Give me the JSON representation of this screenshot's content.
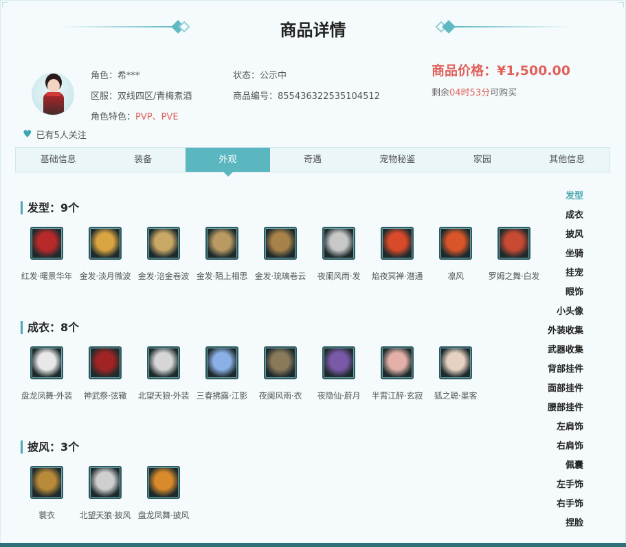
{
  "page": {
    "title": "商品详情"
  },
  "profile": {
    "role_label": "角色：",
    "role_value": "希***",
    "server_label": "区服：",
    "server_value": "双线四区/青梅煮酒",
    "feature_label": "角色特色：",
    "feature_value": "PVP、PVE",
    "status_label": "状态：",
    "status_value": "公示中",
    "goods_id_label": "商品编号：",
    "goods_id_value": "855436322535104512",
    "follow_text": "已有5人关注"
  },
  "price": {
    "label": "商品价格：",
    "value": "¥1,500.00",
    "remain_prefix": "剩余",
    "remain_time": "04时53分",
    "remain_suffix": "可购买"
  },
  "tabs": [
    {
      "label": "基础信息",
      "active": false
    },
    {
      "label": "装备",
      "active": false
    },
    {
      "label": "外观",
      "active": true
    },
    {
      "label": "奇遇",
      "active": false
    },
    {
      "label": "宠物秘鉴",
      "active": false
    },
    {
      "label": "家园",
      "active": false
    },
    {
      "label": "其他信息",
      "active": false
    }
  ],
  "sections": [
    {
      "title": "发型：9个",
      "items": [
        {
          "label": "红发·曙景华年",
          "icon": "red-hair-icon",
          "color": "#b82a2a"
        },
        {
          "label": "金发·淡月微波",
          "icon": "gold-hair-icon",
          "color": "#d9a441"
        },
        {
          "label": "金发·涪金卷波",
          "icon": "gold-curly-hair-icon",
          "color": "#c9a866"
        },
        {
          "label": "金发·陌上相思",
          "icon": "gold-long-hair-icon",
          "color": "#b89a62"
        },
        {
          "label": "金发·琉璃卷云",
          "icon": "gold-cloud-hair-icon",
          "color": "#a9824a"
        },
        {
          "label": "夜阑风雨·发",
          "icon": "silver-hair-icon",
          "color": "#c8c8c8"
        },
        {
          "label": "焰夜冥禅·潜通",
          "icon": "flame-icon",
          "color": "#d84a2a"
        },
        {
          "label": "凛风",
          "icon": "flame-icon",
          "color": "#d8562a"
        },
        {
          "label": "罗姆之舞·白发",
          "icon": "flame-icon",
          "color": "#c94a33"
        }
      ]
    },
    {
      "title": "成衣：8个",
      "items": [
        {
          "label": "盘龙凤舞·外装",
          "icon": "white-robe-icon",
          "color": "#e8e8e8"
        },
        {
          "label": "神武祭·弦辙",
          "icon": "red-armor-icon",
          "color": "#a02424"
        },
        {
          "label": "北望天狼·外装",
          "icon": "silver-robe-icon",
          "color": "#d6d6d6"
        },
        {
          "label": "三春拂露·江影",
          "icon": "blue-robe-icon",
          "color": "#8ab0e6"
        },
        {
          "label": "夜阑风雨·衣",
          "icon": "dark-robe-icon",
          "color": "#8a7a5a"
        },
        {
          "label": "夜隐仙·蔚月",
          "icon": "purple-robe-icon",
          "color": "#7a5aa8"
        },
        {
          "label": "半霄江醉·玄寂",
          "icon": "pink-robe-icon",
          "color": "#e2b0a8"
        },
        {
          "label": "狐之聪·墨客",
          "icon": "horn-icon",
          "color": "#e6d2c2"
        }
      ]
    },
    {
      "title": "披风：3个",
      "items": [
        {
          "label": "蓑衣",
          "icon": "straw-cape-icon",
          "color": "#b88a3a"
        },
        {
          "label": "北望天狼·披风",
          "icon": "white-cape-icon",
          "color": "#cfcfcf"
        },
        {
          "label": "盘龙凤舞·披风",
          "icon": "gold-cape-icon",
          "color": "#d98a2a"
        }
      ]
    }
  ],
  "side_nav": [
    {
      "label": "发型",
      "active": true
    },
    {
      "label": "成衣",
      "active": false
    },
    {
      "label": "披风",
      "active": false
    },
    {
      "label": "坐骑",
      "active": false
    },
    {
      "label": "挂宠",
      "active": false
    },
    {
      "label": "眼饰",
      "active": false
    },
    {
      "label": "小头像",
      "active": false
    },
    {
      "label": "外装收集",
      "active": false
    },
    {
      "label": "武器收集",
      "active": false
    },
    {
      "label": "背部挂件",
      "active": false
    },
    {
      "label": "面部挂件",
      "active": false
    },
    {
      "label": "腰部挂件",
      "active": false
    },
    {
      "label": "左肩饰",
      "active": false
    },
    {
      "label": "右肩饰",
      "active": false
    },
    {
      "label": "佩囊",
      "active": false
    },
    {
      "label": "左手饰",
      "active": false
    },
    {
      "label": "右手饰",
      "active": false
    },
    {
      "label": "捏脸",
      "active": false
    }
  ],
  "colors": {
    "accent": "#5ab6bf",
    "price": "#e0605a",
    "bottom_bar": "#2f6f78"
  }
}
